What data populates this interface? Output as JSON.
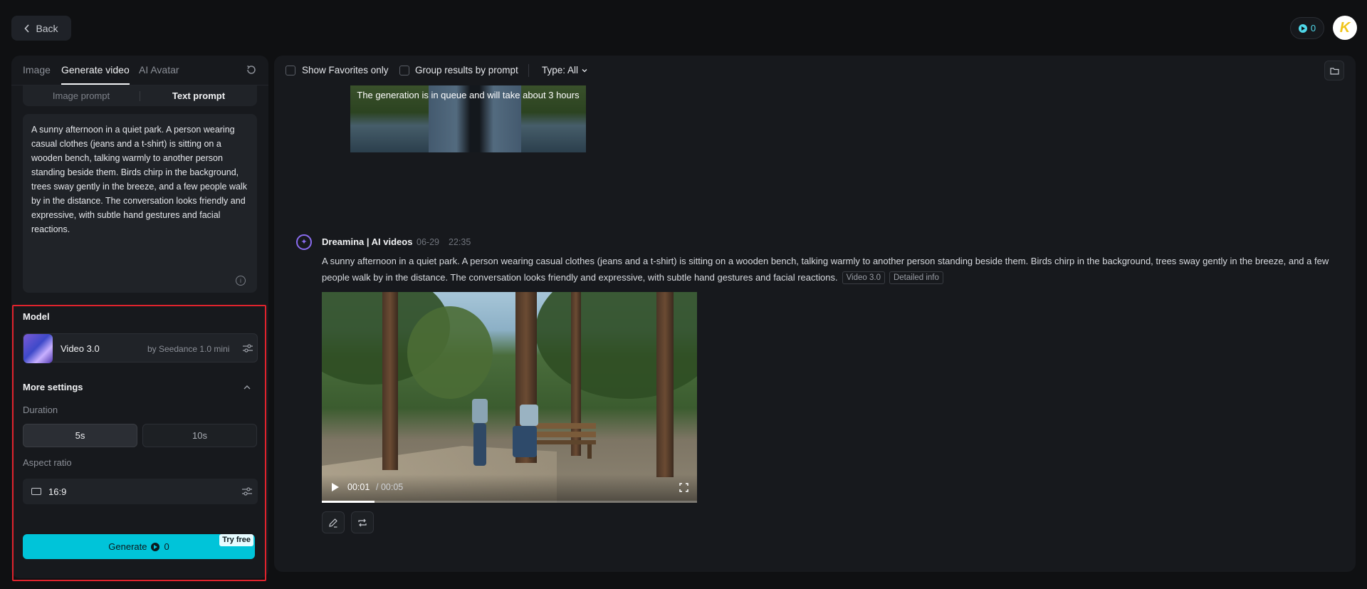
{
  "header": {
    "back_label": "Back",
    "credits": "0"
  },
  "left_panel": {
    "tabs": [
      {
        "label": "Image"
      },
      {
        "label": "Generate video"
      },
      {
        "label": "AI Avatar"
      }
    ],
    "active_tab": "Generate video",
    "prompt_modes": [
      {
        "label": "Image prompt"
      },
      {
        "label": "Text prompt"
      }
    ],
    "active_prompt_mode": "Text prompt",
    "prompt_text": "A sunny afternoon in a quiet park. A person wearing casual clothes (jeans and a t-shirt) is sitting on a wooden bench, talking warmly to another person standing beside them. Birds chirp in the background, trees sway gently in the breeze, and a few people walk by in the distance. The conversation looks friendly and expressive, with subtle hand gestures and facial reactions.",
    "model": {
      "section_label": "Model",
      "name": "Video 3.0",
      "by": "by Seedance 1.0 mini"
    },
    "more_settings": {
      "label": "More settings",
      "duration_label": "Duration",
      "durations": [
        {
          "label": "5s"
        },
        {
          "label": "10s"
        }
      ],
      "selected_duration": "5s",
      "aspect_label": "Aspect ratio",
      "aspect_value": "16:9"
    },
    "generate": {
      "label": "Generate",
      "cost": "0",
      "badge": "Try free"
    }
  },
  "main": {
    "toolbar": {
      "favorites_label": "Show Favorites only",
      "group_label": "Group results by prompt",
      "type_filter": "Type: All"
    },
    "queue_notice": "The generation is in queue and will take about 3 hours",
    "message": {
      "author": "Dreamina | AI videos",
      "date": "06-29",
      "time": "22:35",
      "text": "A sunny afternoon in a quiet park. A person wearing casual clothes (jeans and a t-shirt) is sitting on a wooden bench, talking warmly to another person standing beside them. Birds chirp in the background, trees sway gently in the breeze, and a few people walk by in the distance. The conversation looks friendly and expressive, with subtle hand gestures and facial reactions.",
      "tags": [
        {
          "label": "Video 3.0"
        },
        {
          "label": "Detailed info"
        }
      ]
    },
    "video": {
      "current_time": "00:01",
      "total_time": "/ 00:05",
      "progress": 0.14
    }
  },
  "colors": {
    "accent": "#00c4d9",
    "highlight_frame": "#e0232d",
    "brand_icon": "#8a6cf0"
  }
}
